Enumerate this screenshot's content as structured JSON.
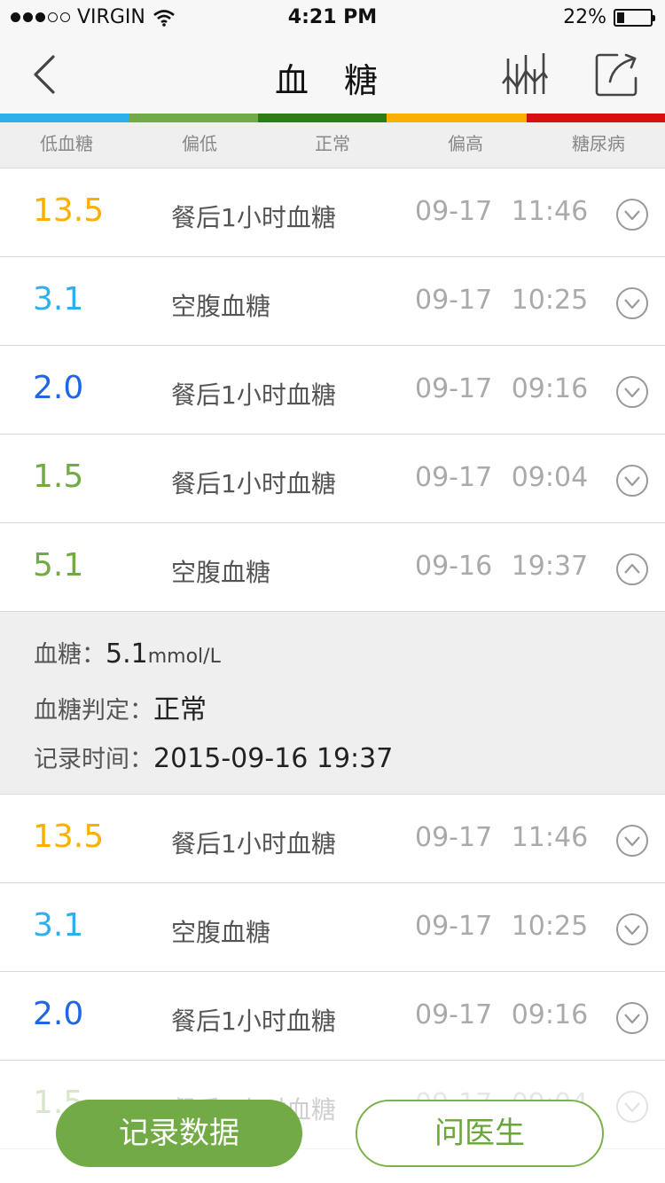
{
  "status_bar": {
    "carrier": "VIRGIN",
    "time": "4:21 PM",
    "battery": "22%",
    "battery_level": 0.22,
    "signal_bars": 3
  },
  "nav": {
    "title": "血 糖",
    "back_icon": "chevron-left-icon",
    "chart_icon": "chart-icon",
    "share_icon": "share-icon"
  },
  "levels": {
    "colors": [
      "#2bb0ec",
      "#72aa45",
      "#2e7d14",
      "#fbb000",
      "#d80f0f"
    ],
    "labels": [
      "低血糖",
      "偏低",
      "正常",
      "偏高",
      "糖尿病"
    ]
  },
  "records": [
    {
      "value": "13.5",
      "color": "#fbb000",
      "type": "餐后1小时血糖",
      "time": "09-17 11:46",
      "expanded": false
    },
    {
      "value": "3.1",
      "color": "#2bb0ec",
      "type": "空腹血糖",
      "time": "09-17 10:25",
      "expanded": false
    },
    {
      "value": "2.0",
      "color": "#1f66e5",
      "type": "餐后1小时血糖",
      "time": "09-17 09:16",
      "expanded": false
    },
    {
      "value": "1.5",
      "color": "#72aa45",
      "type": "餐后1小时血糖",
      "time": "09-17 09:04",
      "expanded": false
    },
    {
      "value": "5.1",
      "color": "#72aa45",
      "type": "空腹血糖",
      "time": "09-16 19:37",
      "expanded": true
    },
    {
      "value": "13.5",
      "color": "#fbb000",
      "type": "餐后1小时血糖",
      "time": "09-17 11:46",
      "expanded": false
    },
    {
      "value": "3.1",
      "color": "#2bb0ec",
      "type": "空腹血糖",
      "time": "09-17 10:25",
      "expanded": false
    },
    {
      "value": "2.0",
      "color": "#1f66e5",
      "type": "餐后1小时血糖",
      "time": "09-17 09:16",
      "expanded": false
    },
    {
      "value": "1.5",
      "color": "#72aa45",
      "type": "餐后1小时血糖",
      "time": "09-17 09:04",
      "expanded": false
    }
  ],
  "detail": {
    "sugar_label": "血糖：",
    "sugar_value": "5.1",
    "sugar_unit": "mmol/L",
    "judge_label": "血糖判定：",
    "judge_value": "正常",
    "time_label": "记录时间：",
    "time_value": "2015-09-16 19:37"
  },
  "buttons": {
    "record": "记录数据",
    "ask": "问医生"
  }
}
